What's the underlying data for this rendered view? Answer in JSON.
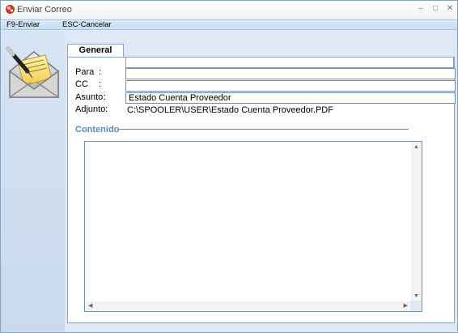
{
  "window": {
    "title": "Enviar Correo",
    "minimize_icon": "minimize-icon",
    "maximize_icon": "maximize-icon",
    "close_icon": "close-icon",
    "app_icon": "app-icon"
  },
  "menu": {
    "send": "F9-Enviar",
    "cancel": "ESC-Cancelar"
  },
  "tabs": [
    {
      "label": "General",
      "active": true
    }
  ],
  "form": {
    "para_label": "Para",
    "cc_label": "CC",
    "asunto_label": "Asunto",
    "adjunto_label": "Adjunto",
    "colon": ":",
    "para_value": "",
    "cc_value": "",
    "asunto_value": "Estado Cuenta Proveedor",
    "adjunto_value": "C:\\SPOOLER\\USER\\Estado Cuenta Proveedor.PDF"
  },
  "contenido": {
    "title": "Contenido",
    "body": ""
  },
  "colors": {
    "accent": "#5b87c0",
    "window_bg": "#dfe9f5",
    "border": "#8aa2c0"
  },
  "side_icon": "mail-envelope-pen-icon"
}
